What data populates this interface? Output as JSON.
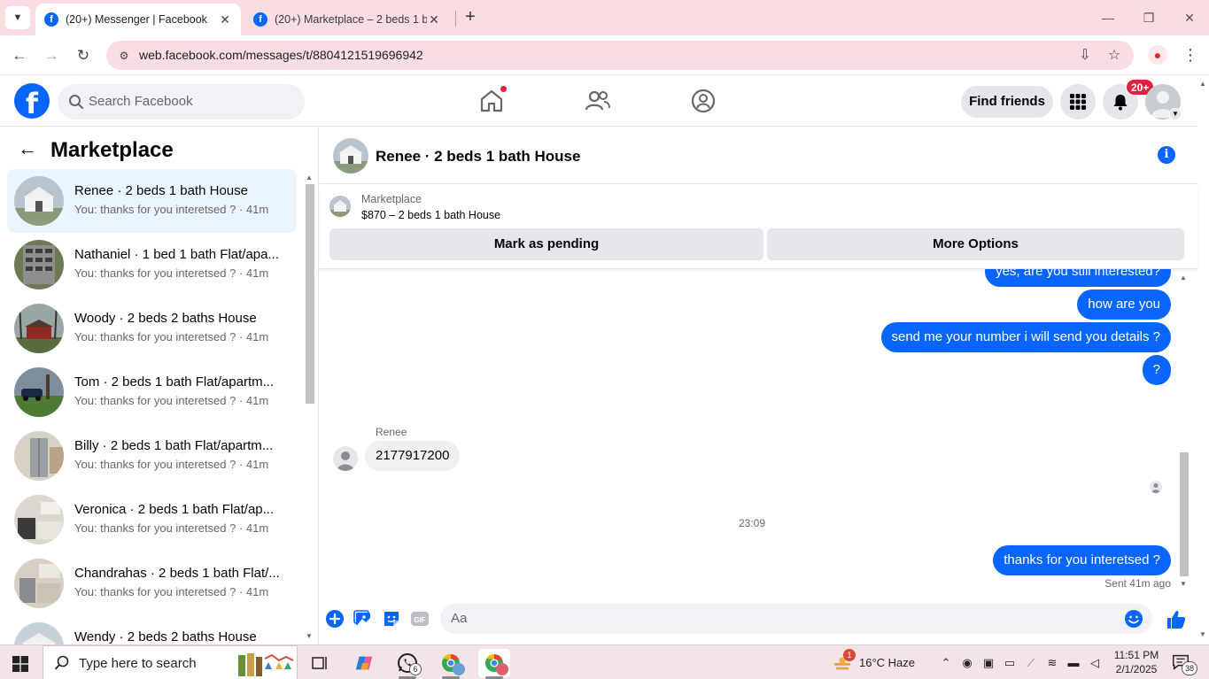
{
  "browser": {
    "tabs": [
      {
        "title": "(20+) Messenger | Facebook",
        "active": true
      },
      {
        "title": "(20+) Marketplace – 2 beds 1 b",
        "active": false
      }
    ],
    "url": "web.facebook.com/messages/t/8804121519696942"
  },
  "header": {
    "search_placeholder": "Search Facebook",
    "find_friends_label": "Find friends",
    "notification_count": "20+"
  },
  "sidebar": {
    "title": "Marketplace",
    "conversations": [
      {
        "name": "Renee · 2 beds 1 bath House",
        "preview": "You: thanks for you interetsed ? · 41m",
        "selected": true
      },
      {
        "name": "Nathaniel · 1 bed 1 bath Flat/apa...",
        "preview": "You: thanks for you interetsed ? · 41m",
        "selected": false
      },
      {
        "name": "Woody · 2 beds 2 baths House",
        "preview": "You: thanks for you interetsed ? · 41m",
        "selected": false
      },
      {
        "name": "Tom · 2 beds 1 bath Flat/apartm...",
        "preview": "You: thanks for you interetsed ? · 41m",
        "selected": false
      },
      {
        "name": "Billy · 2 beds 1 bath Flat/apartm...",
        "preview": "You: thanks for you interetsed ? · 41m",
        "selected": false
      },
      {
        "name": "Veronica · 2 beds 1 bath Flat/ap...",
        "preview": "You: thanks for you interetsed ? · 41m",
        "selected": false
      },
      {
        "name": "Chandrahas · 2 beds 1 bath Flat/...",
        "preview": "You: thanks for you interetsed ? · 41m",
        "selected": false
      },
      {
        "name": "Wendy · 2 beds 2 baths House",
        "preview": "",
        "selected": false
      }
    ]
  },
  "chat": {
    "title": "Renee · 2 beds 1 bath House",
    "listing_label": "Marketplace",
    "listing_price": "$870 – 2 beds 1 bath House",
    "mark_pending_label": "Mark as pending",
    "more_options_label": "More Options",
    "messages": [
      {
        "text": "yes, are you still interested?",
        "from": "me"
      },
      {
        "text": "how are you",
        "from": "me"
      },
      {
        "text": "send me your number i will send you details ?",
        "from": "me"
      },
      {
        "text": "?",
        "from": "me"
      },
      {
        "text": "2177917200",
        "from": "Renee"
      },
      {
        "text": "thanks for you interetsed ?",
        "from": "me"
      }
    ],
    "incoming_sender": "Renee",
    "timestamp": "23:09",
    "sent_status": "Sent 41m ago",
    "composer_placeholder": "Aa"
  },
  "taskbar": {
    "search_placeholder": "Type here to search",
    "whatsapp_count": "6",
    "weather": "16°C  Haze",
    "weather_alert": "1",
    "time": "11:51 PM",
    "date": "2/1/2025",
    "notification_count": "38"
  },
  "colors": {
    "fb_blue": "#0866ff",
    "chrome_pink": "#f9dde3",
    "selected_row": "#ebf5ff",
    "badge_red": "#e41e3f"
  }
}
